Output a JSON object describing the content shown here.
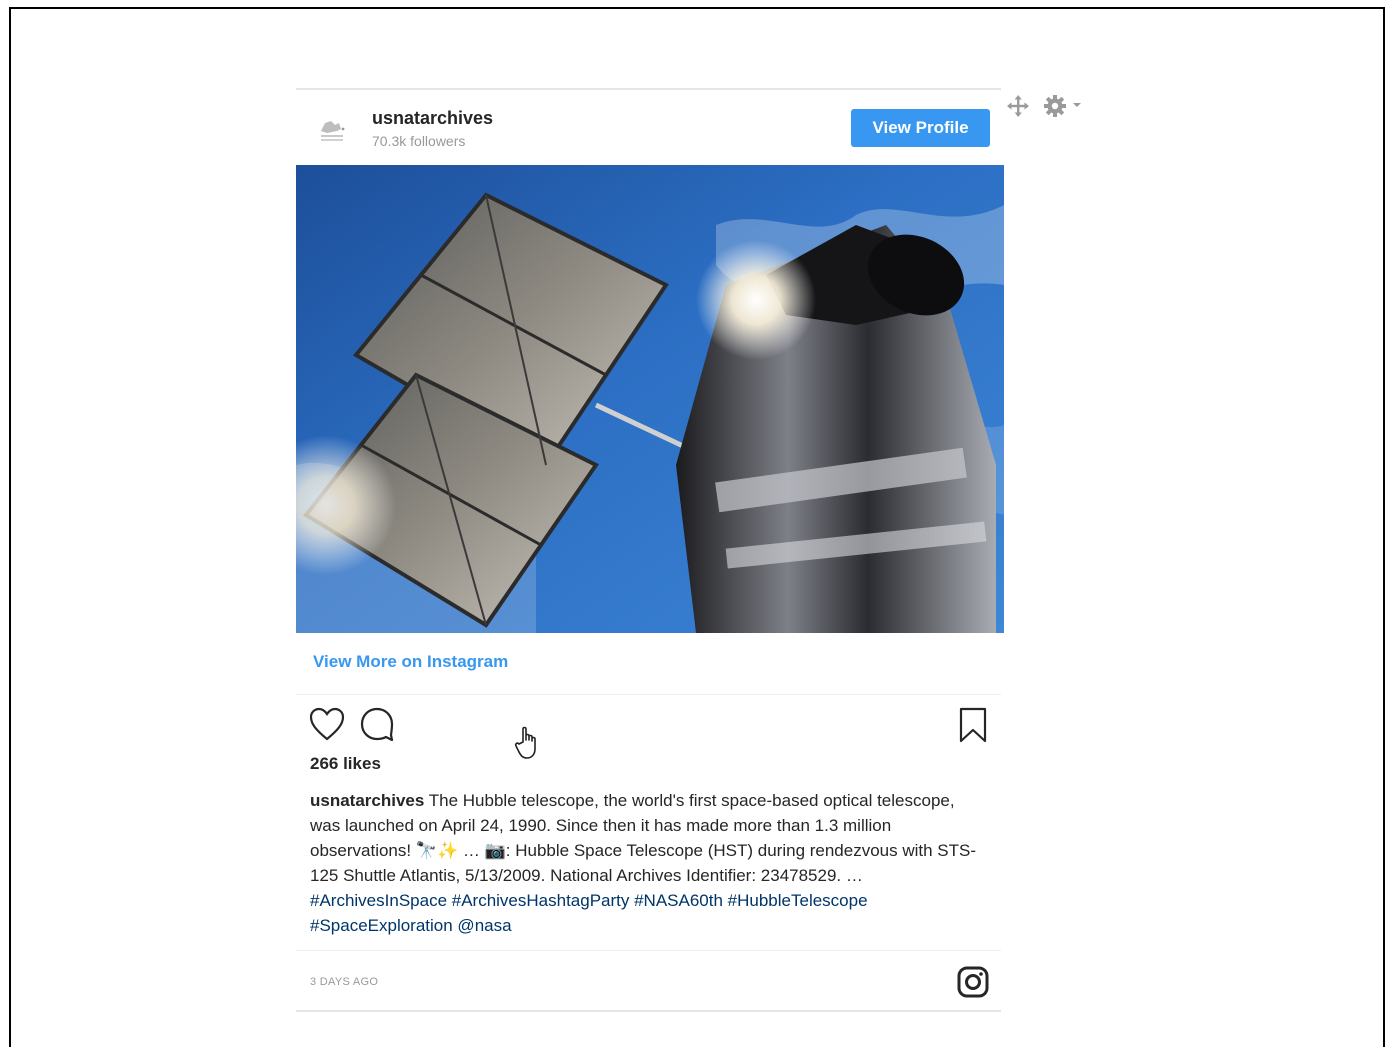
{
  "profile": {
    "username": "usnatarchives",
    "followers": "70.3k followers",
    "view_profile_label": "View Profile"
  },
  "post": {
    "image_alt": "Hubble Space Telescope in orbit above Earth",
    "view_more_label": "View More on Instagram",
    "likes": "266 likes",
    "caption_user": "usnatarchives",
    "caption_text": " The Hubble telescope, the world's first space-based optical telescope, was launched on April 24, 1990. Since then it has made more than 1.3 million observations! 🔭✨ … 📷: Hubble Space Telescope (HST) during rendezvous with STS-125 Shuttle Atlantis, 5/13/2009. National Archives Identifier: 23478529. … ",
    "caption_tags": "#ArchivesInSpace #ArchivesHashtagParty #NASA60th #HubbleTelescope #SpaceExploration @nasa",
    "time": "3 DAYS AGO"
  },
  "icons": {
    "heart": "heart-icon",
    "comment": "comment-icon",
    "bookmark": "bookmark-icon",
    "instagram": "instagram-icon",
    "move": "move-icon",
    "settings": "gear-icon"
  },
  "colors": {
    "accent": "#3897f0",
    "hashtag": "#003569",
    "muted": "#999999"
  }
}
